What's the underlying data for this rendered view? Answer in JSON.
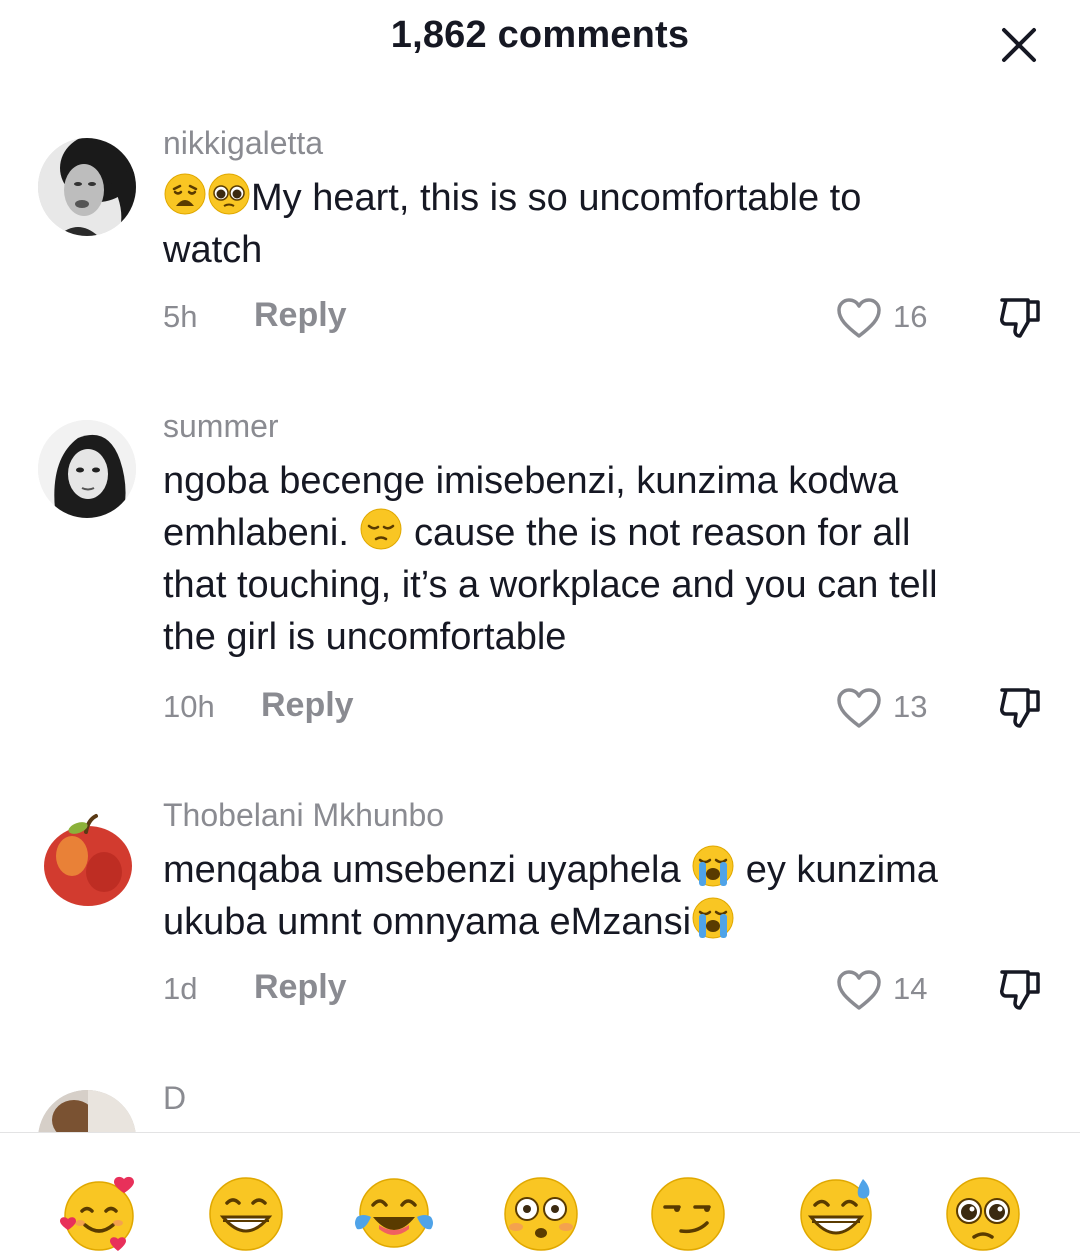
{
  "header": {
    "title": "1,862 comments",
    "close_icon": "close-icon"
  },
  "comments": [
    {
      "username": "nikkigaletta",
      "emoji_prefix": [
        "weary-face-emoji",
        "pleading-face-emoji"
      ],
      "text_line1": "My heart, this is so uncomfortable to",
      "text_line2": "watch",
      "time": "5h",
      "reply": "Reply",
      "likes": "16"
    },
    {
      "username": "summer",
      "text_line1": "ngoba becenge imisebenzi, kunzima kodwa",
      "text_line2a": "emhlabeni. ",
      "text_line2_emoji": "pensive-face-emoji",
      "text_line2b": " cause the is not reason for all",
      "text_line3": "that touching, it’s a workplace and you can tell",
      "text_line4": "the girl is uncomfortable",
      "time": "10h",
      "reply": "Reply",
      "likes": "13"
    },
    {
      "username": "Thobelani Mkhunbo",
      "text_line1a": "menqaba umsebenzi uyaphela ",
      "text_line1_emoji": "loudly-crying-face-emoji",
      "text_line1b": " ey kunzima",
      "text_line2a": "ukuba umnt omnyama eMzansi",
      "text_line2_emoji": "loudly-crying-face-emoji",
      "time": "1d",
      "reply": "Reply",
      "likes": "14"
    },
    {
      "username": "D"
    }
  ],
  "quick_emojis": [
    "smiling-face-with-hearts-emoji",
    "grinning-face-emoji",
    "face-with-tears-of-joy-emoji",
    "flushed-face-emoji",
    "smirking-face-emoji",
    "grinning-face-with-sweat-emoji",
    "pleading-face-emoji"
  ],
  "colors": {
    "text": "#161823",
    "secondary": "#8a8b91",
    "emoji_yellow": "#f9c623",
    "divider": "#e3e3e4"
  }
}
